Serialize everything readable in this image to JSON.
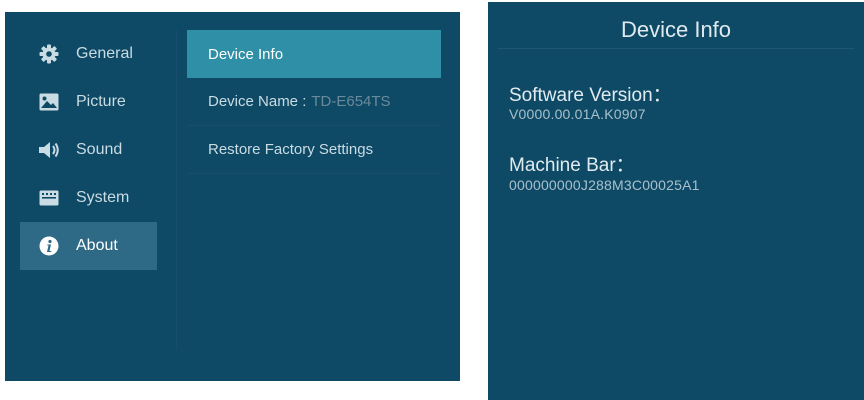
{
  "left_panel": {
    "sidebar": {
      "items": [
        {
          "label": "General",
          "icon": "gear-icon"
        },
        {
          "label": "Picture",
          "icon": "image-icon"
        },
        {
          "label": "Sound",
          "icon": "speaker-icon"
        },
        {
          "label": "System",
          "icon": "keyboard-icon"
        },
        {
          "label": "About",
          "icon": "info-icon",
          "active": true
        }
      ]
    },
    "content": {
      "items": [
        {
          "label": "Device Info",
          "active": true
        },
        {
          "label": "Device Name : ",
          "value": "TD-E654TS"
        },
        {
          "label": "Restore Factory Settings"
        }
      ]
    }
  },
  "right_panel": {
    "title": "Device Info",
    "fields": [
      {
        "label": "Software Version：",
        "value": "V0000.00.01A.K0907"
      },
      {
        "label": "Machine Bar：",
        "value": "000000000J288M3C00025A1"
      }
    ]
  },
  "colors": {
    "panel_bg": "#0e4a66",
    "sidebar_active": "#2e6a86",
    "content_active": "#2f8fa6",
    "text": "#c9dbe3",
    "dim_text": "#6a8a9a"
  }
}
